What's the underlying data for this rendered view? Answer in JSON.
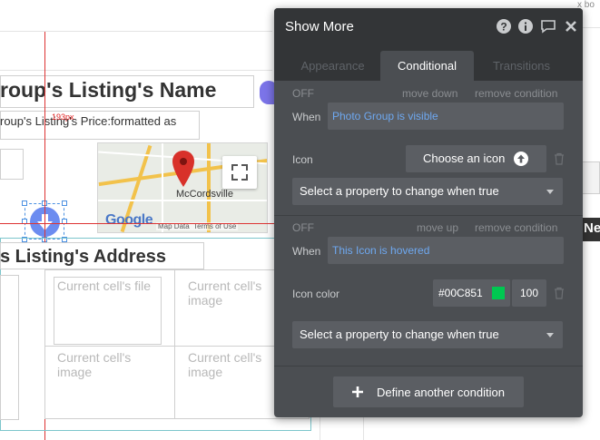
{
  "canvas": {
    "listing_name": "roup's Listing's Name",
    "listing_price": "roup's Listing's Price:formatted as",
    "px_label": "193px",
    "listing_address": "s Listing's Address",
    "map_city": "McCordsville",
    "map_logo": "Google",
    "map_attr_data": "Map Data",
    "map_attr_terms": "Terms of Use",
    "cells": [
      "Current cell's file",
      "Current cell's image",
      "Current cell's image",
      "Current cell's image"
    ],
    "right_fragment": "Ne",
    "top_right_fragment": "x bo"
  },
  "panel": {
    "title": "Show More",
    "header_icons": [
      "help-icon",
      "info-icon",
      "comment-icon",
      "close-icon"
    ],
    "tabs": [
      {
        "label": "Appearance",
        "active": false
      },
      {
        "label": "Conditional",
        "active": true
      },
      {
        "label": "Transitions",
        "active": false
      }
    ],
    "conditions": [
      {
        "status": "OFF",
        "move": "move down",
        "remove": "remove condition",
        "when_label": "When",
        "when_value": "Photo Group is visible",
        "property_label": "Icon",
        "property_button": "Choose an icon",
        "select_placeholder": "Select a property to change when true"
      },
      {
        "status": "OFF",
        "move": "move up",
        "remove": "remove condition",
        "when_label": "When",
        "when_value": "This Icon is hovered",
        "property_label": "Icon color",
        "color_value": "#00C851",
        "color_swatch": "#00C851",
        "opacity_value": "100",
        "select_placeholder": "Select a property to change when true"
      }
    ],
    "define_button": "Define another condition"
  }
}
